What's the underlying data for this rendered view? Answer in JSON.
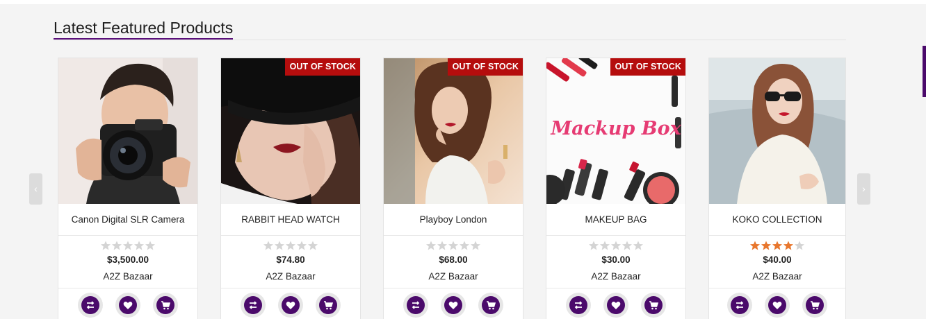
{
  "section": {
    "title": "Latest Featured Products"
  },
  "carousel": {
    "prev_glyph": "‹",
    "next_glyph": "›"
  },
  "colors": {
    "accent": "#4b0a6b",
    "badge": "#b50d0d",
    "star_filled": "#e8772e",
    "star_empty": "#d4d4d4"
  },
  "products": [
    {
      "name": "Canon Digital SLR Camera",
      "price": "$3,500.00",
      "vendor": "A2Z Bazaar",
      "rating": 0,
      "badge": "",
      "image": "camera-photographer-image"
    },
    {
      "name": "RABBIT HEAD WATCH",
      "price": "$74.80",
      "vendor": "A2Z Bazaar",
      "rating": 0,
      "badge": "OUT OF STOCK",
      "image": "woman-hat-image"
    },
    {
      "name": "Playboy London",
      "price": "$68.00",
      "vendor": "A2Z Bazaar",
      "rating": 0,
      "badge": "OUT OF STOCK",
      "image": "woman-perfume-image"
    },
    {
      "name": "MAKEUP BAG",
      "price": "$30.00",
      "vendor": "A2Z Bazaar",
      "rating": 0,
      "badge": "OUT OF STOCK",
      "image": "makeup-box-image",
      "image_text": "Mackup Box"
    },
    {
      "name": "KOKO COLLECTION",
      "price": "$40.00",
      "vendor": "A2Z Bazaar",
      "rating": 4,
      "badge": "",
      "image": "woman-sunglasses-image"
    }
  ],
  "actions": [
    "compare-icon",
    "wishlist-heart-icon",
    "cart-icon"
  ]
}
